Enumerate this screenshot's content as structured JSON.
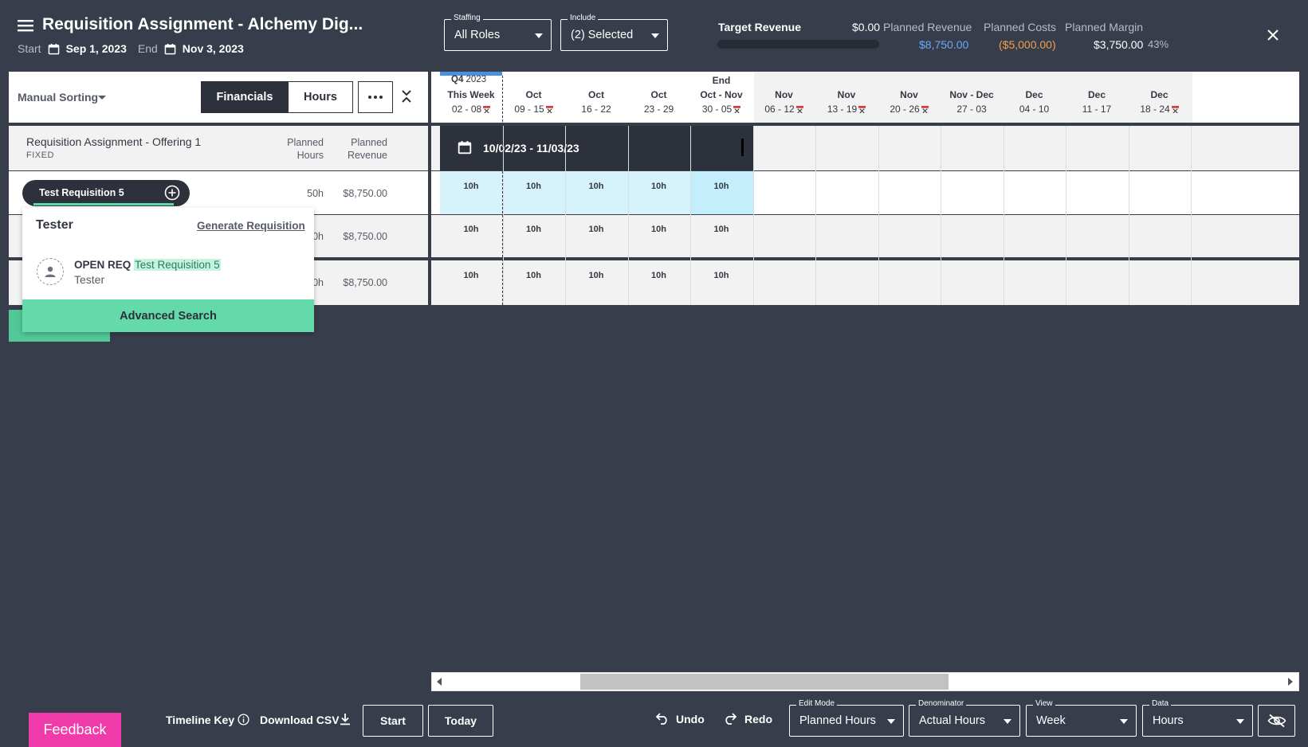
{
  "header": {
    "title": "Requisition Assignment - Alchemy Dig...",
    "start_label": "Start",
    "start_date": "Sep 1, 2023",
    "end_label": "End",
    "end_date": "Nov 3, 2023"
  },
  "filters": {
    "staffing": {
      "caption": "Staffing",
      "value": "All Roles"
    },
    "include": {
      "caption": "Include",
      "value": "(2) Selected"
    }
  },
  "metrics": {
    "target_revenue_label": "Target Revenue",
    "target_revenue_value": "$0.00",
    "planned_revenue_label": "Planned Revenue",
    "planned_revenue_value": "$8,750.00",
    "planned_costs_label": "Planned Costs",
    "planned_costs_value": "($5,000.00)",
    "planned_margin_label": "Planned Margin",
    "planned_margin_value": "$3,750.00",
    "planned_margin_pct": "43%",
    "target_progress": 0.0
  },
  "toolbar": {
    "sort_label": "Manual Sorting",
    "financials_label": "Financials",
    "hours_label": "Hours"
  },
  "group": {
    "title": "Requisition Assignment - Offering 1",
    "subtitle": "FIXED",
    "col_planned_hours_1": "Planned",
    "col_planned_hours_2": "Hours",
    "col_planned_revenue_1": "Planned",
    "col_planned_revenue_2": "Revenue"
  },
  "rows": [
    {
      "label": "Test Requisition 5",
      "hours": "50h",
      "revenue": "$8,750.00"
    },
    {
      "hours": "0h",
      "revenue": "$8,750.00"
    },
    {
      "hours": "0h",
      "revenue": "$8,750.00"
    }
  ],
  "popup": {
    "role": "Tester",
    "generate_label": "Generate Requisition",
    "open_req_prefix": "OPEN REQ",
    "open_req_name": "Test Requisition 5",
    "open_req_role": "Tester",
    "advanced_search": "Advanced Search"
  },
  "timeline": {
    "quarter": "Q4",
    "year": "2023",
    "columns": [
      {
        "top": "",
        "month": "This Week",
        "days": "02 - 08",
        "flag": true
      },
      {
        "top": "",
        "month": "Oct",
        "days": "09 - 15",
        "flag": true
      },
      {
        "top": "",
        "month": "Oct",
        "days": "16 - 22",
        "flag": false
      },
      {
        "top": "",
        "month": "Oct",
        "days": "23 - 29",
        "flag": false
      },
      {
        "top": "End",
        "month": "Oct - Nov",
        "days": "30 - 05",
        "flag": true
      },
      {
        "top": "",
        "month": "Nov",
        "days": "06 - 12",
        "flag": true
      },
      {
        "top": "",
        "month": "Nov",
        "days": "13 - 19",
        "flag": true
      },
      {
        "top": "",
        "month": "Nov",
        "days": "20 - 26",
        "flag": true
      },
      {
        "top": "",
        "month": "Nov - Dec",
        "days": "27 - 03",
        "flag": false
      },
      {
        "top": "",
        "month": "Dec",
        "days": "04 - 10",
        "flag": false
      },
      {
        "top": "",
        "month": "Dec",
        "days": "11 - 17",
        "flag": false
      },
      {
        "top": "",
        "month": "Dec",
        "days": "18 - 24",
        "flag": true
      }
    ],
    "range_label": "10/02/23 - 11/03/23",
    "row_cells": [
      [
        "10h",
        "10h",
        "10h",
        "10h",
        "10h"
      ],
      [
        "10h",
        "10h",
        "10h",
        "10h",
        "10h"
      ],
      [
        "10h",
        "10h",
        "10h",
        "10h",
        "10h"
      ]
    ]
  },
  "footer": {
    "feedback": "Feedback",
    "timeline_key": "Timeline Key",
    "download_csv": "Download CSV",
    "start": "Start",
    "today": "Today",
    "undo": "Undo",
    "redo": "Redo",
    "edit_mode": {
      "caption": "Edit Mode",
      "value": "Planned Hours"
    },
    "denominator": {
      "caption": "Denominator",
      "value": "Actual Hours"
    },
    "view": {
      "caption": "View",
      "value": "Week"
    },
    "data": {
      "caption": "Data",
      "value": "Hours"
    }
  },
  "colors": {
    "background": "#373d4a",
    "accent_green": "#64d9a9",
    "planned_revenue": "#6aa9f5",
    "planned_costs": "#f0a04b",
    "feedback": "#f03caa",
    "highlight_cell": "#d6f3fc"
  }
}
